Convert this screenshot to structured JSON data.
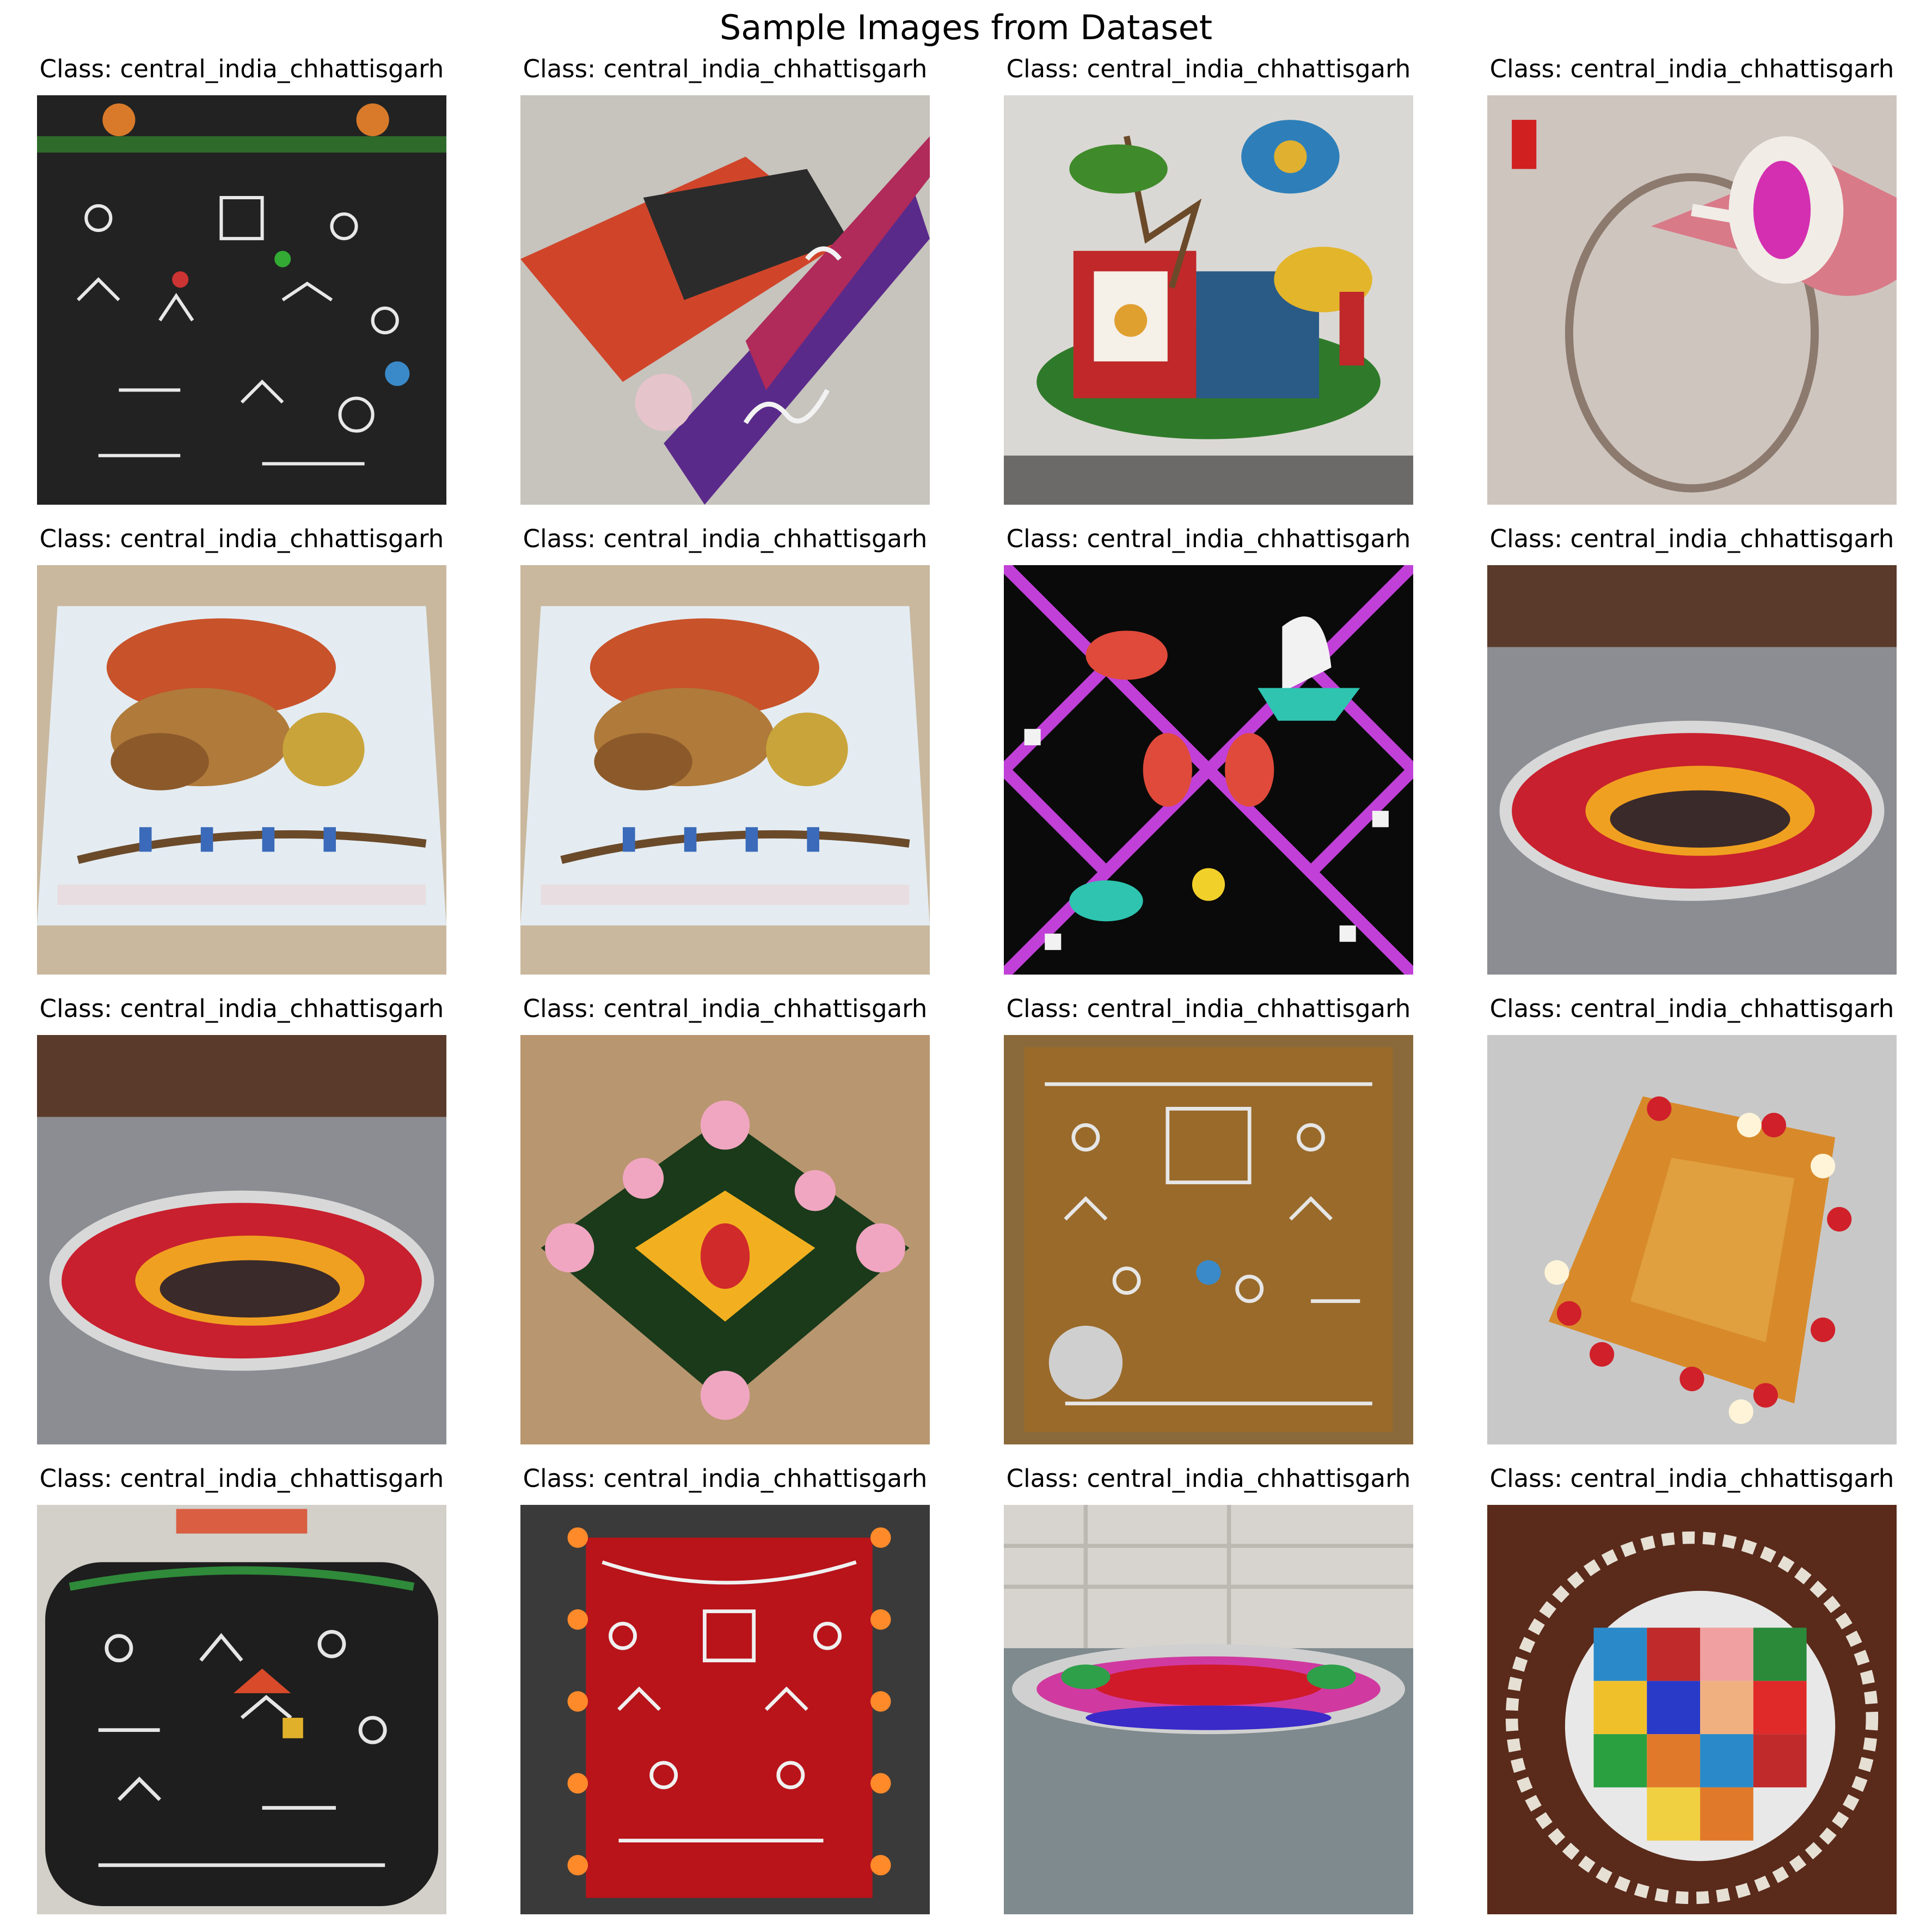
{
  "figure": {
    "title": "Sample Images from Dataset"
  },
  "panels": [
    {
      "label": "Class: central_india_chhattisgarh",
      "scene": "black-board-drawings"
    },
    {
      "label": "Class: central_india_chhattisgarh",
      "scene": "diagonal-rangoli-banner"
    },
    {
      "label": "Class: central_india_chhattisgarh",
      "scene": "tulsi-vivah-rangoli"
    },
    {
      "label": "Class: central_india_chhattisgarh",
      "scene": "hand-cone-circle"
    },
    {
      "label": "Class: central_india_chhattisgarh",
      "scene": "painted-festival-scene"
    },
    {
      "label": "Class: central_india_chhattisgarh",
      "scene": "painted-festival-scene"
    },
    {
      "label": "Class: central_india_chhattisgarh",
      "scene": "patola-pattern"
    },
    {
      "label": "Class: central_india_chhattisgarh",
      "scene": "red-circle-rangoli"
    },
    {
      "label": "Class: central_india_chhattisgarh",
      "scene": "red-circle-rangoli"
    },
    {
      "label": "Class: central_india_chhattisgarh",
      "scene": "lotus-square-rangoli"
    },
    {
      "label": "Class: central_india_chhattisgarh",
      "scene": "brown-board-drawings"
    },
    {
      "label": "Class: central_india_chhattisgarh",
      "scene": "diya-rangoli"
    },
    {
      "label": "Class: central_india_chhattisgarh",
      "scene": "black-rounded-board"
    },
    {
      "label": "Class: central_india_chhattisgarh",
      "scene": "red-board-lights"
    },
    {
      "label": "Class: central_india_chhattisgarh",
      "scene": "floor-oval-rangoli"
    },
    {
      "label": "Class: central_india_chhattisgarh",
      "scene": "mandala-color-grid"
    }
  ]
}
